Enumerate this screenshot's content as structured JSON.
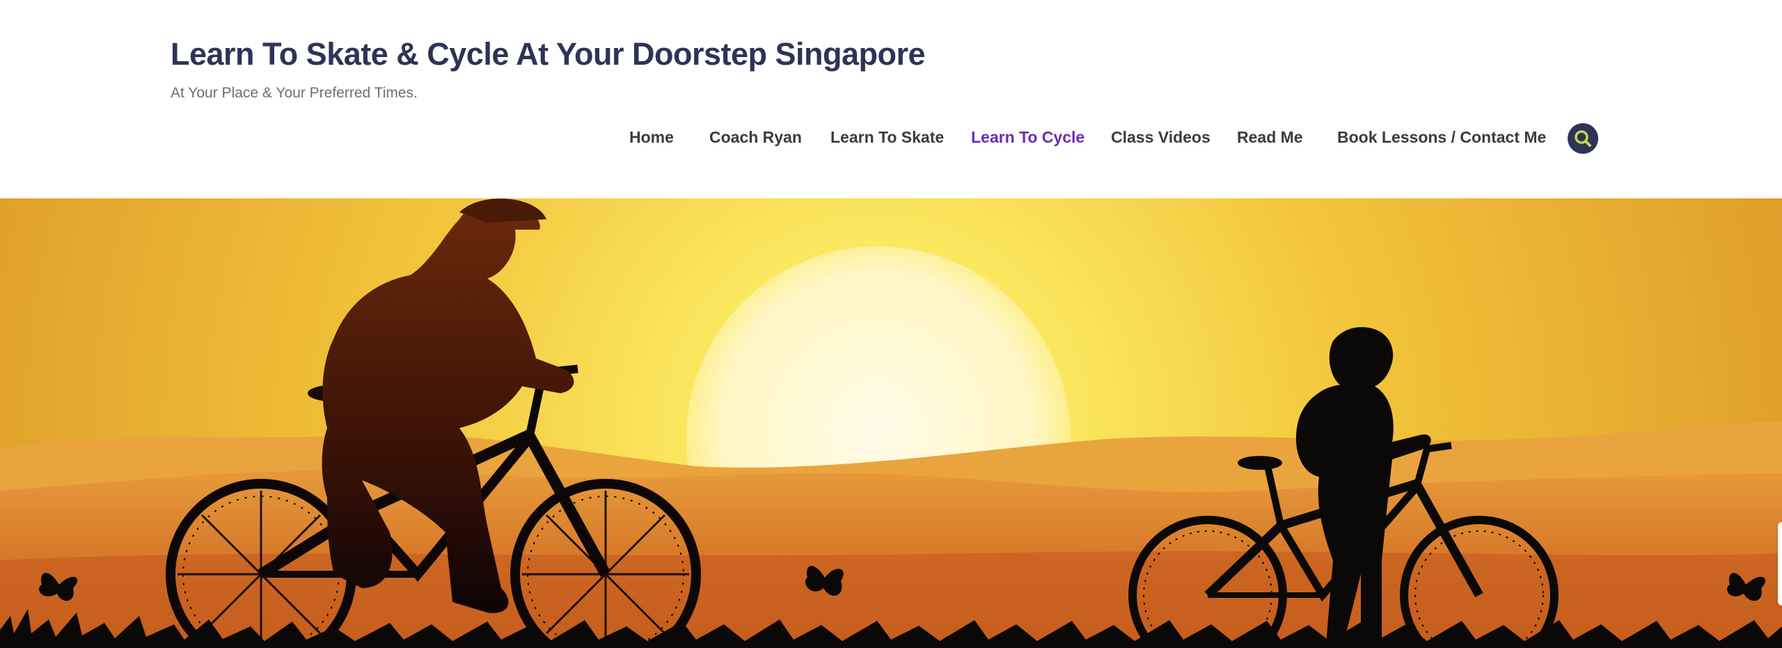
{
  "site": {
    "title": "Learn To Skate & Cycle At Your Doorstep Singapore",
    "tagline": "At Your Place & Your Preferred Times."
  },
  "nav": {
    "items": [
      {
        "label": "Home",
        "active": false
      },
      {
        "label": "Coach Ryan",
        "active": false
      },
      {
        "label": "Learn To Skate",
        "active": false
      },
      {
        "label": "Learn To Cycle",
        "active": true
      },
      {
        "label": "Class Videos",
        "active": false
      },
      {
        "label": "Read Me",
        "active": false
      },
      {
        "label": "Book Lessons / Contact Me",
        "active": false
      }
    ],
    "search_icon": "search-icon"
  },
  "colors": {
    "brand": "#2e3357",
    "active_link": "#6c2bb4",
    "nav_text": "#3c3c3c",
    "search_accent": "#c5d94a"
  },
  "hero": {
    "image": "sunset-cyclists-illustration"
  }
}
